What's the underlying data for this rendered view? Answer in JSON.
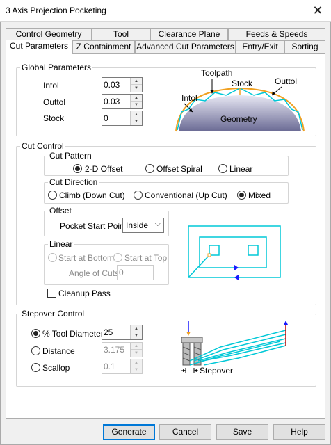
{
  "window": {
    "title": "3 Axis Projection Pocketing",
    "close_glyph": "✕"
  },
  "tabs_row1": [
    "Control Geometry",
    "Tool",
    "Clearance Plane",
    "Feeds & Speeds"
  ],
  "tabs_row2": [
    "Cut Parameters",
    "Z Containment",
    "Advanced Cut Parameters",
    "Entry/Exit",
    "Sorting"
  ],
  "active_tab": "Cut Parameters",
  "global": {
    "legend": "Global Parameters",
    "intol_label": "Intol",
    "intol_value": "0.03",
    "outtol_label": "Outtol",
    "outtol_value": "0.03",
    "stock_label": "Stock",
    "stock_value": "0",
    "diagram": {
      "toolpath": "Toolpath",
      "stock": "Stock",
      "outtol": "Outtol",
      "intol": "Intol",
      "geometry": "Geometry"
    }
  },
  "cut_control": {
    "legend": "Cut Control",
    "pattern": {
      "legend": "Cut Pattern",
      "options": [
        "2-D Offset",
        "Offset Spiral",
        "Linear"
      ],
      "selected": "2-D Offset"
    },
    "direction": {
      "legend": "Cut Direction",
      "options": [
        "Climb (Down Cut)",
        "Conventional (Up Cut)",
        "Mixed"
      ],
      "selected": "Mixed"
    },
    "offset": {
      "legend": "Offset",
      "start_label": "Pocket Start Point",
      "start_value": "Inside"
    },
    "linear": {
      "legend": "Linear",
      "start_bottom": "Start at Bottom",
      "start_top": "Start at Top",
      "angle_label": "Angle of Cuts",
      "angle_value": "0"
    },
    "cleanup_label": "Cleanup Pass"
  },
  "stepover": {
    "legend": "Stepover Control",
    "tool_diameter_label": "% Tool Diameter",
    "tool_diameter_value": "25",
    "distance_label": "Distance",
    "distance_value": "3.175",
    "scallop_label": "Scallop",
    "scallop_value": "0.1",
    "selected": "% Tool Diameter",
    "diagram_label": "Stepover"
  },
  "buttons": {
    "generate": "Generate",
    "cancel": "Cancel",
    "save": "Save",
    "help": "Help"
  },
  "colors": {
    "accent": "#0078d7",
    "toolpath": "#00c8d7",
    "stock": "#f0a020",
    "arrow_blue": "#1a1aff",
    "arrow_red": "#c00000"
  },
  "icons": {
    "spin_up": "▲",
    "spin_down": "▼",
    "dropdown": "⌵"
  }
}
